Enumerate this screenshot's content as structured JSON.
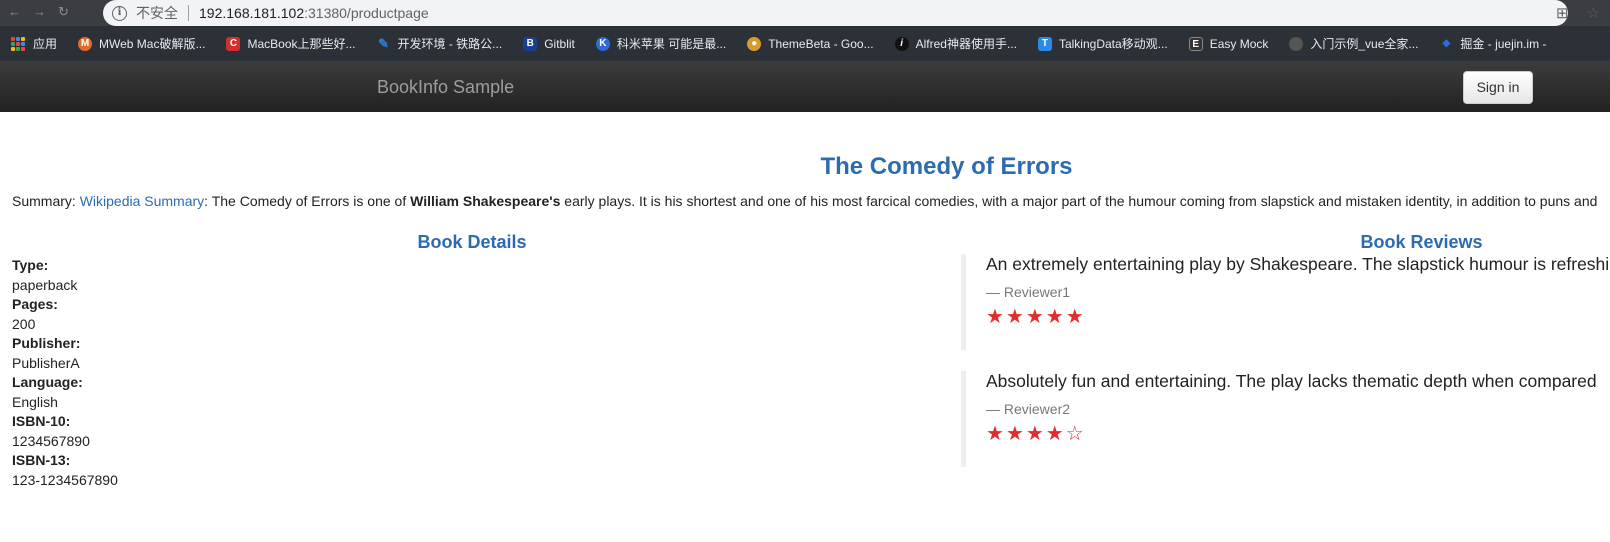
{
  "browser": {
    "insecure_label": "不安全",
    "url_host": "192.168.181.102",
    "url_path": ":31380/productpage",
    "bookmarks": [
      {
        "label": "应用",
        "icon": "apps-grid-icon"
      },
      {
        "label": "MWeb Mac破解版...",
        "icon": "mweb-icon",
        "color": "#e06c2c"
      },
      {
        "label": "MacBook上那些好...",
        "icon": "c-icon",
        "color": "#d0312d"
      },
      {
        "label": "开发环境 - 铁路公...",
        "icon": "pen-icon",
        "color": "#2e7cd6"
      },
      {
        "label": "Gitblit",
        "icon": "gitblit-icon",
        "color": "#1b3f8f"
      },
      {
        "label": "科米苹果 可能是最...",
        "icon": "k-icon",
        "color": "#2d6bd8"
      },
      {
        "label": "ThemeBeta - Goo...",
        "icon": "palette-icon",
        "color": "#d69a2d"
      },
      {
        "label": "Alfred神器使用手...",
        "icon": "info-icon",
        "color": "#111111"
      },
      {
        "label": "TalkingData移动观...",
        "icon": "t-icon",
        "color": "#2b8ae8"
      },
      {
        "label": "Easy Mock",
        "icon": "easymock-icon",
        "color": "#333333"
      },
      {
        "label": "入门示例_vue全家...",
        "icon": "github-icon",
        "color": "#555555"
      },
      {
        "label": "掘金 - juejin.im -",
        "icon": "juejin-icon",
        "color": "#2e6ae0"
      }
    ]
  },
  "navbar": {
    "brand": "BookInfo Sample",
    "signin": "Sign in"
  },
  "book": {
    "title": "The Comedy of Errors",
    "summary_prefix": "Summary: ",
    "summary_link": "Wikipedia Summary",
    "summary_text1": ": The Comedy of Errors is one of ",
    "summary_bold": "William Shakespeare's",
    "summary_text2": " early plays. It is his shortest and one of his most farcical comedies, with a major part of the humour coming from slapstick and mistaken identity, in addition to puns and"
  },
  "details": {
    "heading": "Book Details",
    "fields": [
      {
        "key": "Type:",
        "value": "paperback"
      },
      {
        "key": "Pages:",
        "value": "200"
      },
      {
        "key": "Publisher:",
        "value": "PublisherA"
      },
      {
        "key": "Language:",
        "value": "English"
      },
      {
        "key": "ISBN-10:",
        "value": "1234567890"
      },
      {
        "key": "ISBN-13:",
        "value": "123-1234567890"
      }
    ]
  },
  "reviews": {
    "heading": "Book Reviews",
    "items": [
      {
        "text": "An extremely entertaining play by Shakespeare. The slapstick humour is refreshi",
        "reviewer": "— Reviewer1",
        "stars": "★★★★★",
        "rating": 5
      },
      {
        "text": "Absolutely fun and entertaining. The play lacks thematic depth when compared",
        "reviewer": "— Reviewer2",
        "stars": "★★★★☆",
        "rating": 4
      }
    ]
  }
}
